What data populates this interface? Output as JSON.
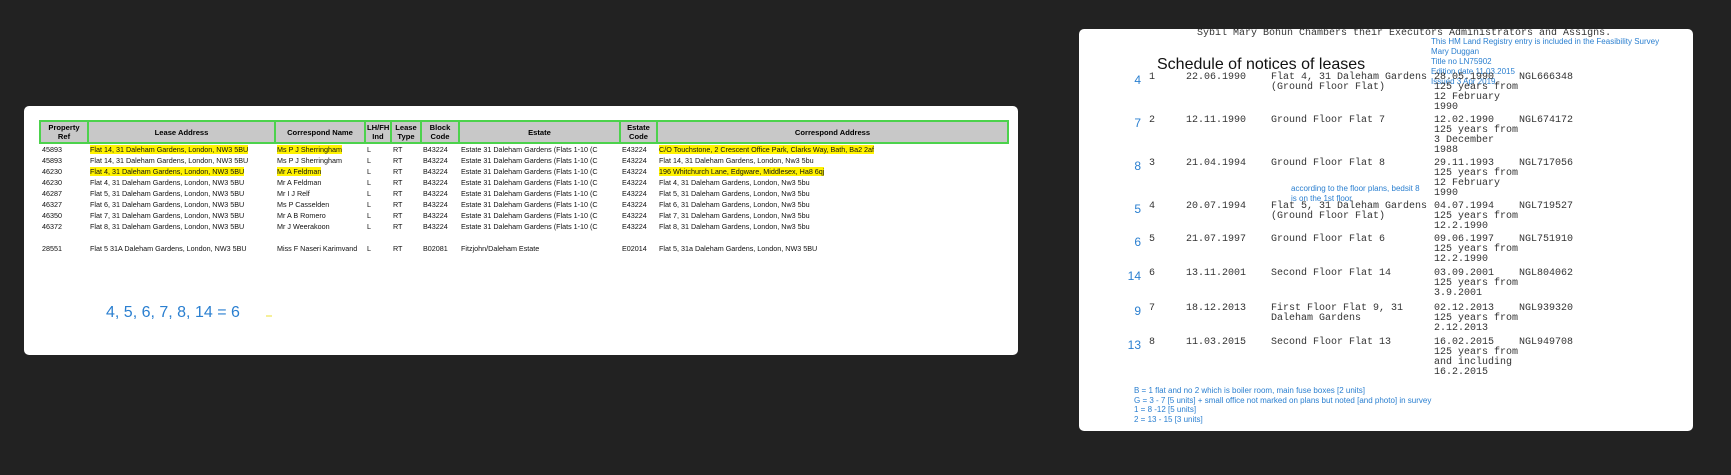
{
  "left_panel": {
    "headers": [
      "Property Ref",
      "Lease Address",
      "Correspond Name",
      "LH/FH Ind",
      "Lease Type",
      "Block Code",
      "Estate",
      "Estate Code",
      "Correspond Address"
    ],
    "rows": [
      {
        "cells": [
          "45893",
          "Flat 14, 31 Daleham Gardens, London, NW3 5BU",
          "Ms P J Sherringham",
          "L",
          "RT",
          "B43224",
          "Estate 31 Daleham Gardens (Flats 1-10 (C",
          "E43224",
          "C/O Touchstone, 2 Crescent Office Park, Clarks Way, Bath, Ba2 2af"
        ],
        "highlight": [
          1,
          2,
          8
        ]
      },
      {
        "cells": [
          "45893",
          "Flat 14, 31 Daleham Gardens, London, NW3 5BU",
          "Ms P J Sherringham",
          "L",
          "RT",
          "B43224",
          "Estate 31 Daleham Gardens (Flats 1-10 (C",
          "E43224",
          "Flat 14, 31 Daleham Gardens, London, Nw3 5bu"
        ],
        "highlight": []
      },
      {
        "cells": [
          "46230",
          "Flat 4, 31 Daleham Gardens, London, NW3 5BU",
          "Mr A Feldman",
          "L",
          "RT",
          "B43224",
          "Estate 31 Daleham Gardens (Flats 1-10 (C",
          "E43224",
          "196 Whitchurch Lane, Edgware, Middlesex, Ha8 6qj"
        ],
        "highlight": [
          1,
          2,
          8
        ]
      },
      {
        "cells": [
          "46230",
          "Flat 4, 31 Daleham Gardens, London, NW3 5BU",
          "Mr A Feldman",
          "L",
          "RT",
          "B43224",
          "Estate 31 Daleham Gardens (Flats 1-10 (C",
          "E43224",
          "Flat 4, 31 Daleham Gardens, London, Nw3 5bu"
        ],
        "highlight": []
      },
      {
        "cells": [
          "46287",
          "Flat 5, 31 Daleham Gardens, London, NW3 5BU",
          "Mr I J Relf",
          "L",
          "RT",
          "B43224",
          "Estate 31 Daleham Gardens (Flats 1-10 (C",
          "E43224",
          "Flat 5, 31 Daleham Gardens, London, Nw3 5bu"
        ],
        "highlight": []
      },
      {
        "cells": [
          "46327",
          "Flat 6, 31 Daleham Gardens, London, NW3 5BU",
          "Ms P Casselden",
          "L",
          "RT",
          "B43224",
          "Estate 31 Daleham Gardens (Flats 1-10 (C",
          "E43224",
          "Flat 6, 31 Daleham Gardens, London, Nw3 5bu"
        ],
        "highlight": []
      },
      {
        "cells": [
          "46350",
          "Flat 7, 31 Daleham Gardens, London, NW3 5BU",
          "Mr A B Romero",
          "L",
          "RT",
          "B43224",
          "Estate 31 Daleham Gardens (Flats 1-10 (C",
          "E43224",
          "Flat 7, 31 Daleham Gardens, London, Nw3 5bu"
        ],
        "highlight": []
      },
      {
        "cells": [
          "46372",
          "Flat 8, 31 Daleham Gardens, London, NW3 5BU",
          "Mr J Weerakoon",
          "L",
          "RT",
          "B43224",
          "Estate 31 Daleham Gardens (Flats 1-10 (C",
          "E43224",
          "Flat 8, 31 Daleham Gardens, London, Nw3 5bu"
        ],
        "highlight": []
      },
      {
        "cells": [
          "",
          "",
          "",
          "",
          "",
          "",
          "",
          "",
          ""
        ],
        "highlight": []
      },
      {
        "cells": [
          "28551",
          "Flat 5 31A Daleham Gardens, London, NW3 5BU",
          "Miss F Naseri Karimvand",
          "L",
          "RT",
          "B02081",
          "Fitzjohn/Daleham Estate",
          "E02014",
          "Flat 5, 31a Daleham Gardens, London, NW3 5BU"
        ],
        "highlight": []
      }
    ],
    "equation_note": "4, 5, 6, 7, 8, 14 = 6"
  },
  "right_panel": {
    "top_line": "Sybil Mary Bohun Chambers their Executors Administrators and Assigns.",
    "survey_note": [
      "This HM Land Registry entry  is included in the Feasibility Survey",
      "Mary Duggan",
      "Title no LN75902",
      "Edition date 11.03.2015",
      "Issued 3 Apr 2019"
    ],
    "schedule_title": "Schedule of notices of leases",
    "entries": [
      {
        "mark": "4",
        "no": "1",
        "reg_date": "22.06.1990",
        "property": "Flat 4, 31 Daleham Gardens\n(Ground Floor Flat)",
        "lease_date": "28.05.1990\n125 years from\n12 February\n1990",
        "title": "NGL666348"
      },
      {
        "mark": "7",
        "no": "2",
        "reg_date": "12.11.1990",
        "property": "Ground Floor Flat 7",
        "lease_date": "12.02.1990\n125 years from\n3 December\n1988",
        "title": "NGL674172"
      },
      {
        "mark": "8",
        "no": "3",
        "reg_date": "21.04.1994",
        "property": "Ground Floor Flat 8",
        "lease_date": "29.11.1993\n125 years from\n12 February\n1990",
        "title": "NGL717056"
      },
      {
        "mark": "5",
        "no": "4",
        "reg_date": "20.07.1994",
        "property": "Flat 5, 31 Daleham Gardens\n(Ground Floor Flat)",
        "lease_date": "04.07.1994\n125 years from\n12.2.1990",
        "title": "NGL719527"
      },
      {
        "mark": "6",
        "no": "5",
        "reg_date": "21.07.1997",
        "property": "Ground Floor Flat 6",
        "lease_date": "09.06.1997\n125 years from\n12.2.1990",
        "title": "NGL751910"
      },
      {
        "mark": "14",
        "no": "6",
        "reg_date": "13.11.2001",
        "property": "Second Floor Flat 14",
        "lease_date": "03.09.2001\n125 years from\n3.9.2001",
        "title": "NGL804062"
      },
      {
        "mark": "9",
        "no": "7",
        "reg_date": "18.12.2013",
        "property": "First Floor Flat 9, 31\nDaleham Gardens",
        "lease_date": "02.12.2013\n125 years from\n2.12.2013",
        "title": "NGL939320"
      },
      {
        "mark": "13",
        "no": "8",
        "reg_date": "11.03.2015",
        "property": "Second Floor Flat 13",
        "lease_date": "16.02.2015\n125 years from\nand including\n16.2.2015",
        "title": "NGL949708"
      }
    ],
    "floor_plan_note": "according to the floor plans, bedsit 8\nis on the 1st floor",
    "unit_notes": [
      "B = 1 flat and no  2 which is boiler room, main fuse boxes [2 units]",
      "G = 3 - 7  [5 units]  + small office not marked on plans but noted [and photo] in survey",
      "1 =  8 -12  [5 units]",
      "2 = 13 - 15 [3 units]"
    ]
  },
  "colors": {
    "background": "#222222",
    "annotation_blue": "#2a7fd0",
    "header_border_green": "#4cd24c",
    "highlight_yellow": "#fff200"
  }
}
